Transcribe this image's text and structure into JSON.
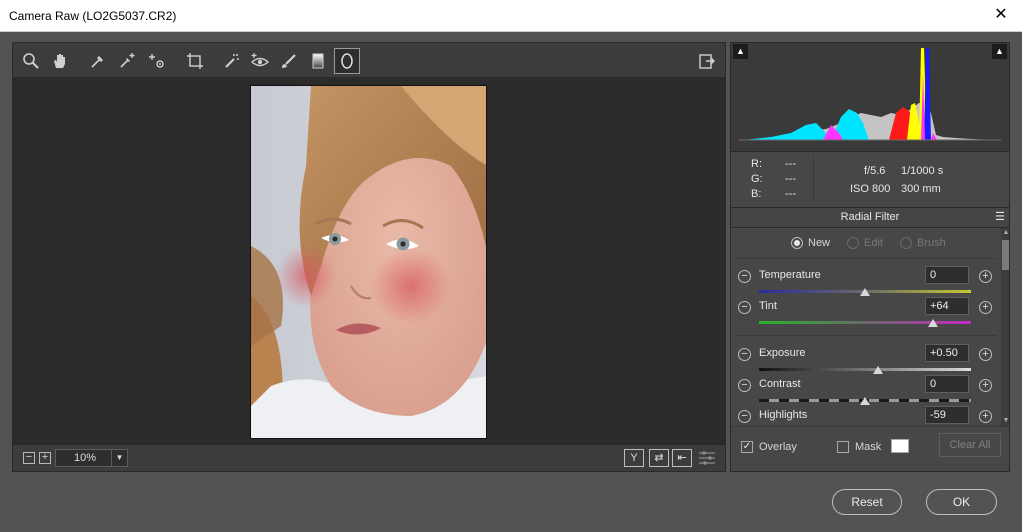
{
  "window": {
    "title": "Camera Raw (LO2G5037.CR2)",
    "close_glyph": "✕"
  },
  "toolbar": {
    "tools": [
      "zoom-icon",
      "hand-icon",
      "white-balance-icon",
      "color-sampler-icon",
      "targeted-adjustment-icon",
      "crop-icon",
      "spot-removal-icon",
      "red-eye-icon",
      "adjustment-brush-icon",
      "graduated-filter-icon",
      "radial-filter-icon"
    ],
    "open_preferences": "preferences-icon"
  },
  "statusbar": {
    "zoom_out": "−",
    "zoom_in": "+",
    "zoom_value": "10%",
    "zoom_arrow": "▼",
    "compare_label": "Y",
    "swap_label": "⇄",
    "copy_label": "⇤"
  },
  "histogram": {
    "shadow_clip": "▲",
    "highlight_clip": "▲"
  },
  "info": {
    "r_label": "R:",
    "r_value": "---",
    "g_label": "G:",
    "g_value": "---",
    "b_label": "B:",
    "b_value": "---",
    "aperture": "f/5.6",
    "shutter": "1/1000 s",
    "iso": "ISO 800",
    "focal": "300 mm"
  },
  "panel": {
    "title": "Radial Filter",
    "menu_glyph": "☰",
    "modes": [
      {
        "label": "New",
        "selected": true
      },
      {
        "label": "Edit",
        "selected": false
      },
      {
        "label": "Brush",
        "selected": false
      }
    ],
    "sliders": [
      {
        "label": "Temperature",
        "value": "0",
        "position": 0.5
      },
      {
        "label": "Tint",
        "value": "+64",
        "position": 0.82
      },
      {
        "label": "Exposure",
        "value": "+0.50",
        "position": 0.56
      },
      {
        "label": "Contrast",
        "value": "0",
        "position": 0.5
      },
      {
        "label": "Highlights",
        "value": "-59",
        "position": 0.2
      }
    ],
    "minus_glyph": "−",
    "plus_glyph": "+"
  },
  "overlay": {
    "overlay_label": "Overlay",
    "overlay_checked": "✓",
    "mask_label": "Mask",
    "mask_color": "#ffffff",
    "clear_all": "Clear All"
  },
  "buttons": {
    "reset": "Reset",
    "ok": "OK"
  },
  "colors": {
    "background": "#535353",
    "panel": "#474747",
    "canvas": "#2b2b2b"
  }
}
